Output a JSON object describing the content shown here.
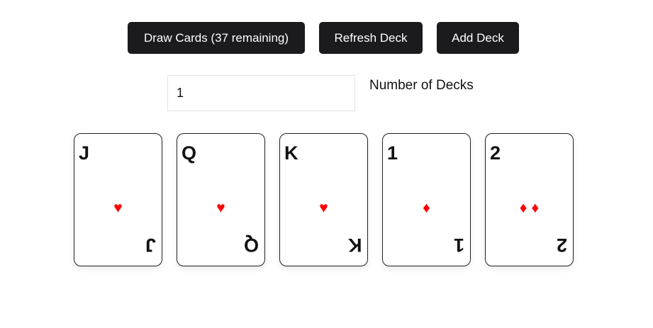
{
  "toolbar": {
    "draw_label": "Draw Cards (37 remaining)",
    "refresh_label": "Refresh Deck",
    "add_label": "Add Deck",
    "button_color": "#1b1b1e"
  },
  "deck_settings": {
    "count_value": "1",
    "count_label": "Number of Decks"
  },
  "cards": [
    {
      "rank": "J",
      "suit_icon": "heart",
      "suits": [
        "♥"
      ]
    },
    {
      "rank": "Q",
      "suit_icon": "heart",
      "suits": [
        "♥"
      ]
    },
    {
      "rank": "K",
      "suit_icon": "heart",
      "suits": [
        "♥"
      ]
    },
    {
      "rank": "1",
      "suit_icon": "diamond",
      "suits": [
        "♦"
      ]
    },
    {
      "rank": "2",
      "suit_icon": "diamond",
      "suits": [
        "♦",
        "♦"
      ]
    }
  ],
  "suit_color": "#ff0000"
}
